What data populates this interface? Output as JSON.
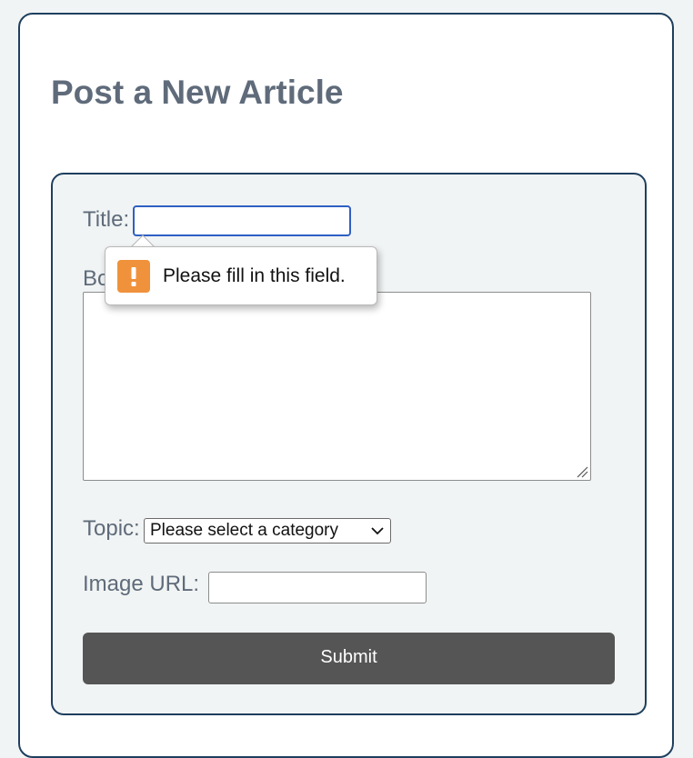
{
  "page": {
    "title": "Post a New Article"
  },
  "form": {
    "title_label": "Title:",
    "title_value": "",
    "body_label": "Body:",
    "body_value": "",
    "topic_label": "Topic:",
    "topic_selected": "Please select a category",
    "image_url_label": "Image URL:",
    "image_url_value": "",
    "submit_label": "Submit"
  },
  "validation": {
    "message": "Please fill in this field.",
    "icon": "exclamation-warning-icon"
  },
  "colors": {
    "border": "#1e3f5e",
    "heading": "#5f6b7a",
    "submit_bg": "#555555",
    "focus": "#2f5fc4",
    "warning": "#f0923c"
  }
}
